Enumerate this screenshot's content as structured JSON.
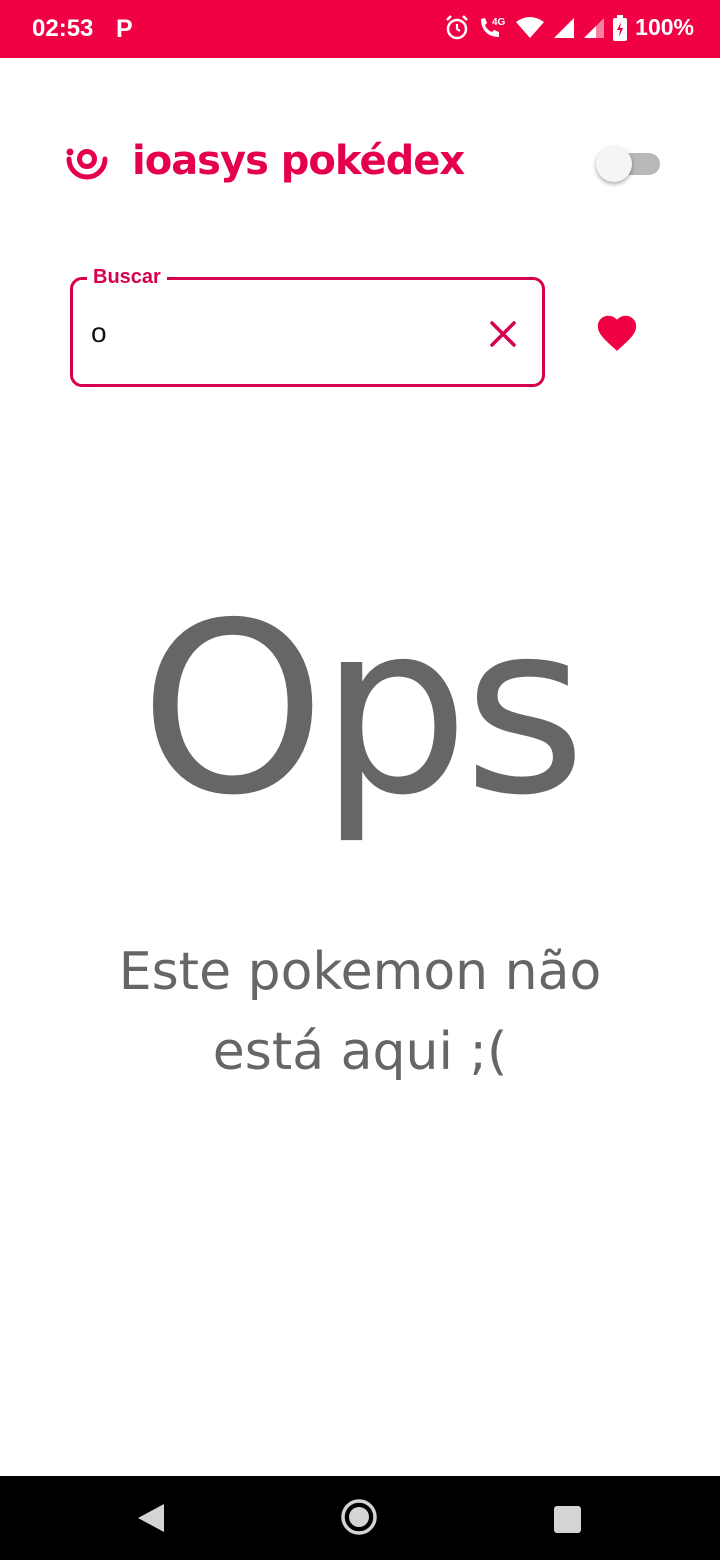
{
  "status_bar": {
    "time": "02:53",
    "app_icon_letter": "P",
    "battery_percent": "100%",
    "icons": [
      "alarm-icon",
      "volte-call-icon",
      "wifi-icon",
      "signal-icon",
      "signal-icon",
      "battery-charging-icon"
    ],
    "network_label": "4G"
  },
  "header": {
    "title": "ioasys pokédex",
    "brand_color": "#e5004f",
    "logo_icon": "ioasys-logo-icon",
    "theme_toggle": {
      "state": "off"
    }
  },
  "search": {
    "label": "Buscar",
    "value": "o",
    "clear_icon": "close-icon"
  },
  "favorites": {
    "icon": "heart-icon",
    "color": "#ef0143"
  },
  "empty_state": {
    "title": "Ops",
    "message": "Este pokemon não está aqui ;("
  },
  "nav_bar": {
    "icons": [
      "back-icon",
      "home-icon",
      "recents-icon"
    ]
  }
}
